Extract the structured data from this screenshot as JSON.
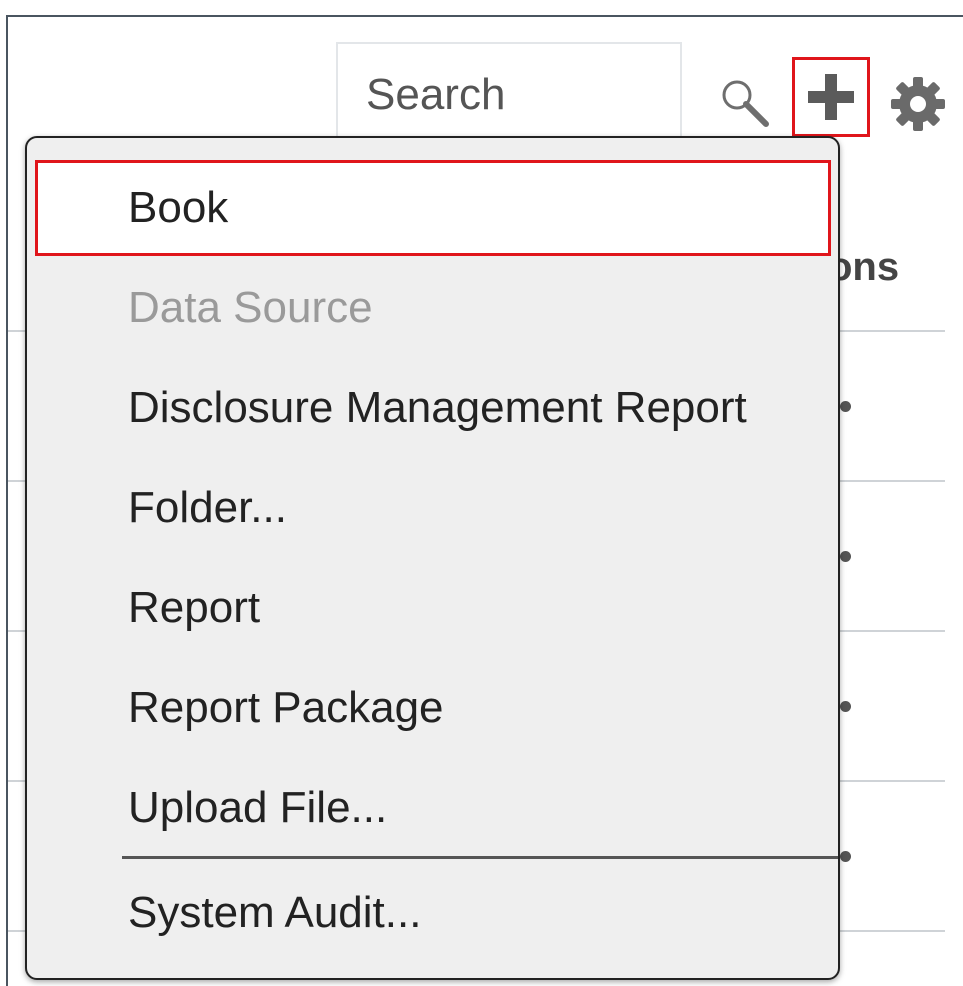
{
  "toolbar": {
    "search_placeholder": "Search",
    "search_icon": "search-icon",
    "add_icon": "plus-icon",
    "settings_icon": "gear-icon",
    "highlight_color": "#e0151b"
  },
  "table": {
    "column_header_partial": "ons"
  },
  "menu": {
    "items": [
      {
        "label": "Book",
        "enabled": true,
        "highlighted": true
      },
      {
        "label": "Data Source",
        "enabled": false
      },
      {
        "label": "Disclosure Management Report",
        "enabled": true
      },
      {
        "label": "Folder...",
        "enabled": true
      },
      {
        "label": "Report",
        "enabled": true
      },
      {
        "label": "Report Package",
        "enabled": true
      },
      {
        "label": "Upload File...",
        "enabled": true
      },
      {
        "label": "System Audit...",
        "enabled": true
      }
    ]
  }
}
